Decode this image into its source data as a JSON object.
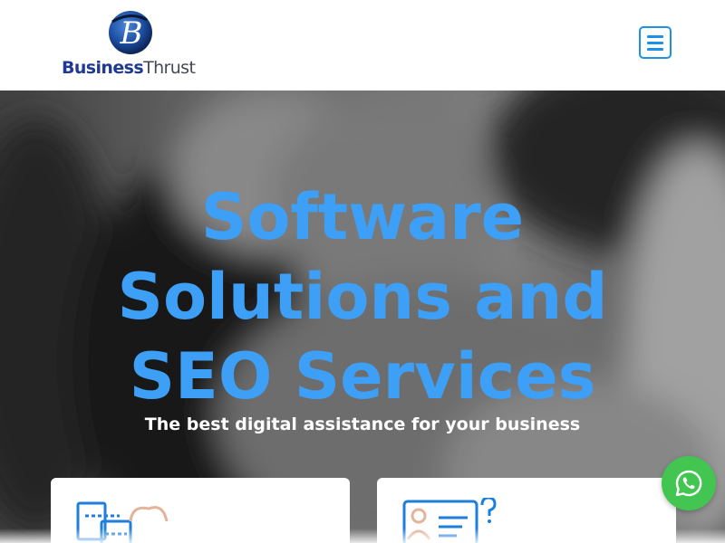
{
  "header": {
    "logo": {
      "text_part_1": "Business",
      "text_part_2": "Thrust",
      "mark_letter": "B"
    },
    "menu_icon": "hamburger-menu-icon"
  },
  "hero": {
    "title_lines": [
      "Software",
      "Solutions and",
      "SEO Services"
    ],
    "subtitle": "The best digital assistance for your business"
  },
  "cards": [
    {
      "icon": "cloud-computer-icon"
    },
    {
      "icon": "support-chat-icon"
    }
  ],
  "floating": {
    "whatsapp_icon": "whatsapp-icon"
  },
  "colors": {
    "accent": "#3d9ff5",
    "brand_navy": "#1f3a93",
    "whatsapp": "#43c552"
  }
}
